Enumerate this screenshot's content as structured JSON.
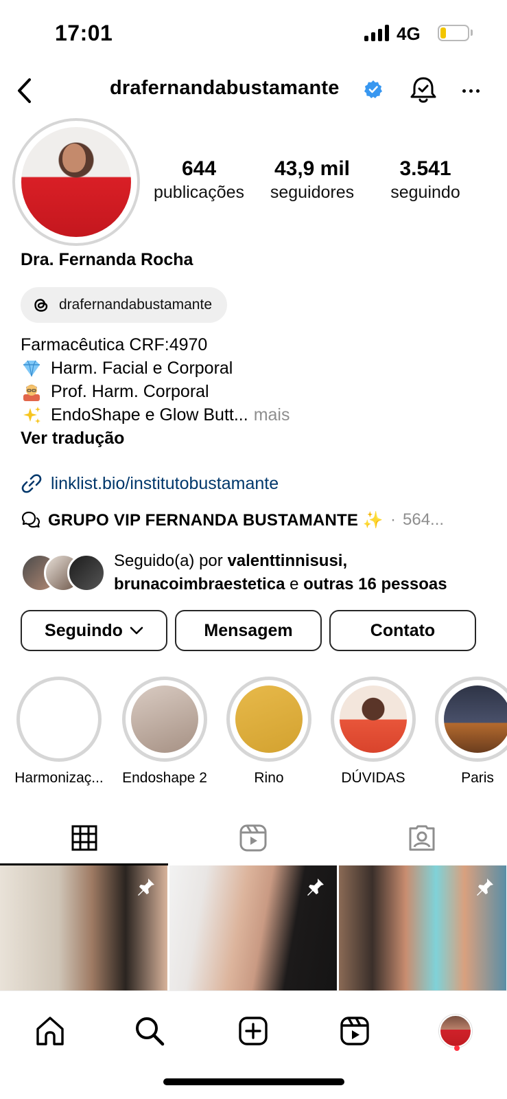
{
  "status_bar": {
    "time": "17:01",
    "network": "4G",
    "battery_level": 0.15,
    "icons": [
      "signal-icon",
      "battery-icon"
    ]
  },
  "header": {
    "username": "drafernandabustamante",
    "verified": true,
    "icons": [
      "back-arrow-icon",
      "verified-badge-icon",
      "notification-bell-icon",
      "more-options-icon"
    ]
  },
  "stats": {
    "posts": {
      "value": "644",
      "label": "publicações"
    },
    "followers": {
      "value": "43,9 mil",
      "label": "seguidores"
    },
    "following": {
      "value": "3.541",
      "label": "seguindo"
    }
  },
  "profile": {
    "display_name": "Dra. Fernanda Rocha",
    "threads_handle": "drafernandabustamante",
    "bio_lines": [
      {
        "text": "Farmacêutica CRF:4970",
        "emoji": ""
      },
      {
        "text": "Harm. Facial e Corporal",
        "emoji": "gem-icon"
      },
      {
        "text": "Prof. Harm. Corporal",
        "emoji": "teacher-icon"
      },
      {
        "text": "EndoShape e Glow Butt...",
        "emoji": "sparkles-icon"
      }
    ],
    "more_label": "mais",
    "translate_label": "Ver tradução",
    "link": "linklist.bio/institutobustamante",
    "group_title": "GRUPO VIP FERNANDA BUSTAMANTE ✨",
    "group_sep": "·",
    "group_count": "564...",
    "followed_by": {
      "prefix": "Seguido(a) por ",
      "user1": "valenttinnisusi",
      "comma": ",",
      "user2": "brunacoimbraestetica",
      "connector": " e ",
      "others": "outras 16 pessoas"
    }
  },
  "actions": {
    "following_label": "Seguindo",
    "message_label": "Mensagem",
    "contact_label": "Contato"
  },
  "highlights": [
    {
      "label": "Harmonizaç...",
      "color": "#ffffff"
    },
    {
      "label": "Endoshape 2",
      "color": "#c9b7ad"
    },
    {
      "label": "Rino",
      "color": "#e0b23a"
    },
    {
      "label": "DÚVIDAS",
      "color": "#e86b52"
    },
    {
      "label": "Paris",
      "color": "#3b4254"
    }
  ],
  "tabs": [
    {
      "name": "grid-icon",
      "active": true
    },
    {
      "name": "reels-icon",
      "active": false
    },
    {
      "name": "tagged-icon",
      "active": false
    }
  ],
  "bottom_nav": [
    "home-icon",
    "search-icon",
    "create-icon",
    "reels-icon",
    "profile-avatar"
  ]
}
